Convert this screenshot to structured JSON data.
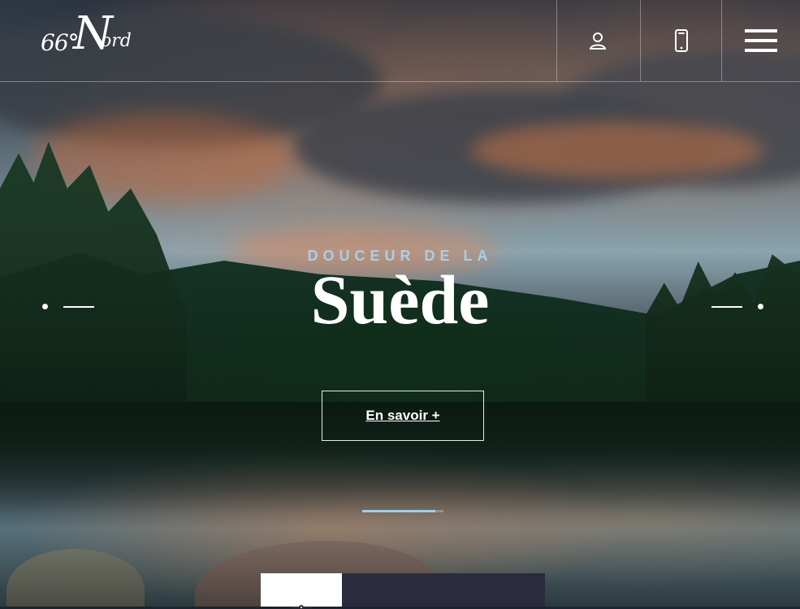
{
  "brand": {
    "logo_number": "66°",
    "logo_initial": "N",
    "logo_rest": "ord"
  },
  "header": {
    "icons": [
      "user-icon",
      "phone-icon",
      "menu-icon"
    ]
  },
  "hero": {
    "kicker": "DOUCEUR DE LA",
    "title": "Suède",
    "cta_label": "En savoir +"
  },
  "slider": {
    "progress": 0.9
  },
  "colors": {
    "kicker": "#a7d0e6",
    "bottom_panel_dark": "#2b2b3f"
  }
}
